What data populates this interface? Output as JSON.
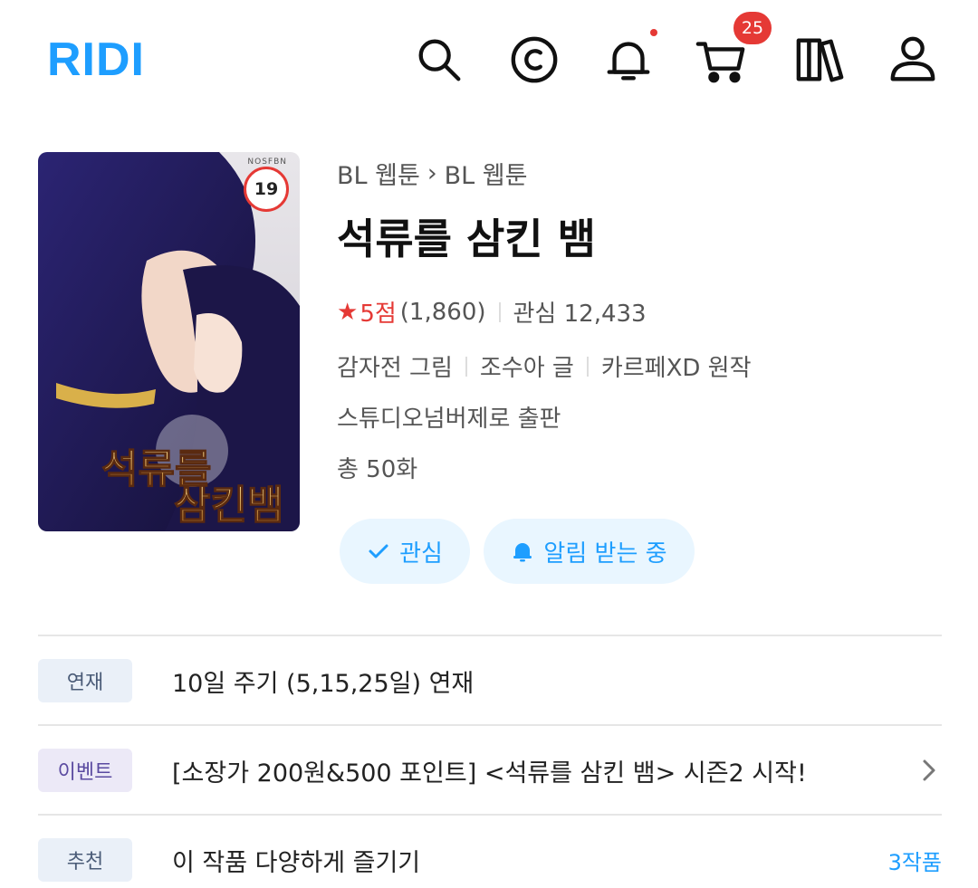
{
  "header": {
    "logo": "RIDI",
    "icons": [
      "search-icon",
      "cash-icon",
      "bell-icon",
      "cart-icon",
      "library-icon",
      "user-icon"
    ],
    "cart_count": "25",
    "accent_color": "#1e9eff"
  },
  "book": {
    "age_rating": "19",
    "cover_brand": "NOSFBN",
    "breadcrumb": [
      "BL 웹툰",
      "BL 웹툰"
    ],
    "title": "석류를 삼킨 뱀",
    "rating_score": "5점",
    "rating_count": "(1,860)",
    "interest": "관심 12,433",
    "credits": [
      "감자전 그림",
      "조수아 글",
      "카르페XD 원작"
    ],
    "publisher": "스튜디오넘버제로 출판",
    "episodes": "총 50화"
  },
  "actions": {
    "interest_label": "관심",
    "notify_label": "알림 받는 중"
  },
  "info_rows": {
    "serial": {
      "tag": "연재",
      "text": "10일 주기 (5,15,25일) 연재"
    },
    "event": {
      "tag": "이벤트",
      "text": "[소장가 200원&500 포인트] <석류를 삼킨 뱀> 시즌2 시작!"
    },
    "recommend": {
      "tag": "추천",
      "text": "이 작품 다양하게 즐기기",
      "link": "3작품"
    }
  }
}
